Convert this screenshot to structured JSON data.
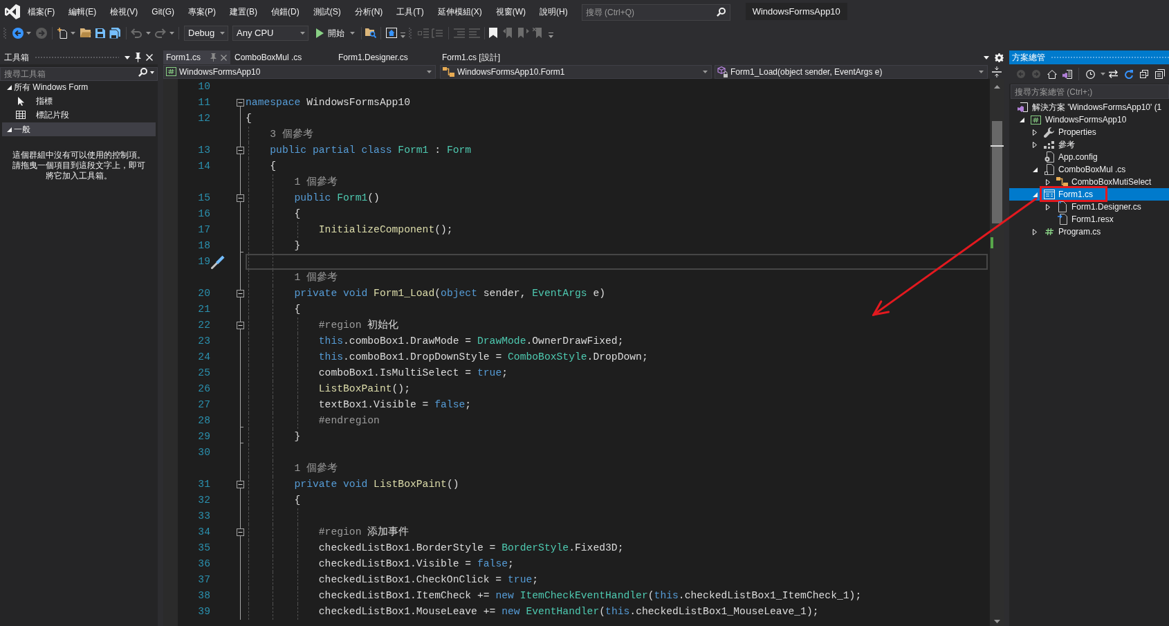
{
  "menu_bar": {
    "items": [
      "檔案(F)",
      "編輯(E)",
      "檢視(V)",
      "Git(G)",
      "專案(P)",
      "建置(B)",
      "偵錯(D)",
      "測試(S)",
      "分析(N)",
      "工具(T)",
      "延伸模組(X)",
      "視窗(W)",
      "說明(H)"
    ],
    "search": {
      "placeholder": "搜尋 (Ctrl+Q)"
    },
    "solution_name": "WindowsFormsApp10"
  },
  "toolbar": {
    "configuration": "Debug",
    "platform": "Any CPU",
    "start": "開始"
  },
  "toolbox": {
    "title": "工具箱",
    "search": {
      "placeholder": "搜尋工具箱"
    },
    "groups": [
      {
        "label": "所有 Windows Form",
        "expanded": true,
        "selected": false,
        "items": [
          {
            "kind": "pointer",
            "label": "指標"
          },
          {
            "kind": "snippets",
            "label": "標記片段"
          }
        ]
      },
      {
        "label": "一般",
        "expanded": true,
        "selected": true,
        "message": "這個群組中沒有可以使用的控制項。請拖曳一個項目到這段文字上，即可將它加入工具箱。"
      }
    ]
  },
  "editor": {
    "tabs": [
      {
        "label": "Form1.cs",
        "selected": true
      },
      {
        "label": "ComboBoxMul .cs",
        "selected": false
      },
      {
        "label": "Form1.Designer.cs",
        "selected": false
      },
      {
        "label": "Form1.cs [設計]",
        "selected": false
      }
    ],
    "navigation": {
      "project": "WindowsFormsApp10",
      "class": "WindowsFormsApp10.Form1",
      "member": "Form1_Load(object sender, EventArgs e)"
    },
    "lines": [
      {
        "kind": "code",
        "number": "10",
        "collapsible": false,
        "block_end": false,
        "current": false
      },
      {
        "kind": "code",
        "number": "11",
        "collapsible": true,
        "block_end": false,
        "current": false,
        "tokens": [
          {
            "kind": "keyword",
            "text": "namespace"
          },
          {
            "kind": "plain",
            "text": " WindowsFormsApp10"
          }
        ]
      },
      {
        "kind": "code",
        "number": "12",
        "collapsible": false,
        "block_end": false,
        "current": false,
        "tokens": [
          {
            "kind": "plain",
            "text": "{"
          }
        ]
      },
      {
        "kind": "codelens",
        "text": "    3 個參考"
      },
      {
        "kind": "code",
        "number": "13",
        "collapsible": true,
        "block_end": false,
        "current": false,
        "tokens": [
          {
            "kind": "keyword",
            "text": "    public partial class "
          },
          {
            "kind": "type",
            "text": "Form1"
          },
          {
            "kind": "plain",
            "text": " : "
          },
          {
            "kind": "type",
            "text": "Form"
          }
        ]
      },
      {
        "kind": "code",
        "number": "14",
        "collapsible": false,
        "block_end": false,
        "current": false,
        "tokens": [
          {
            "kind": "plain",
            "text": "    {"
          }
        ]
      },
      {
        "kind": "codelens",
        "text": "        1 個參考"
      },
      {
        "kind": "code",
        "number": "15",
        "collapsible": true,
        "block_end": false,
        "current": false,
        "tokens": [
          {
            "kind": "keyword",
            "text": "        public "
          },
          {
            "kind": "type",
            "text": "Form1"
          },
          {
            "kind": "plain",
            "text": "()"
          }
        ]
      },
      {
        "kind": "code",
        "number": "16",
        "collapsible": false,
        "block_end": false,
        "current": false,
        "tokens": [
          {
            "kind": "plain",
            "text": "        {"
          }
        ]
      },
      {
        "kind": "code",
        "number": "17",
        "collapsible": false,
        "block_end": false,
        "current": false,
        "tokens": [
          {
            "kind": "method",
            "text": "            InitializeComponent"
          },
          {
            "kind": "plain",
            "text": "();"
          }
        ]
      },
      {
        "kind": "code",
        "number": "18",
        "collapsible": false,
        "block_end": true,
        "current": false,
        "tokens": [
          {
            "kind": "plain",
            "text": "        }"
          }
        ]
      },
      {
        "kind": "code",
        "number": "19",
        "collapsible": false,
        "block_end": false,
        "current": true
      },
      {
        "kind": "codelens",
        "text": "        1 個參考"
      },
      {
        "kind": "code",
        "number": "20",
        "collapsible": true,
        "block_end": false,
        "current": false,
        "tokens": [
          {
            "kind": "keyword",
            "text": "        private void "
          },
          {
            "kind": "method",
            "text": "Form1_Load"
          },
          {
            "kind": "plain",
            "text": "("
          },
          {
            "kind": "keyword",
            "text": "object"
          },
          {
            "kind": "plain",
            "text": " sender, "
          },
          {
            "kind": "type",
            "text": "EventArgs"
          },
          {
            "kind": "plain",
            "text": " e)"
          }
        ]
      },
      {
        "kind": "code",
        "number": "21",
        "collapsible": false,
        "block_end": false,
        "current": false,
        "tokens": [
          {
            "kind": "plain",
            "text": "        {"
          }
        ]
      },
      {
        "kind": "code",
        "number": "22",
        "collapsible": true,
        "block_end": false,
        "current": false,
        "tokens": [
          {
            "kind": "preprocessor",
            "text": "            #region"
          },
          {
            "kind": "plain",
            "text": " 初始化"
          }
        ]
      },
      {
        "kind": "code",
        "number": "23",
        "collapsible": false,
        "block_end": false,
        "current": false,
        "tokens": [
          {
            "kind": "keyword",
            "text": "            this"
          },
          {
            "kind": "plain",
            "text": ".comboBox1.DrawMode = "
          },
          {
            "kind": "type",
            "text": "DrawMode"
          },
          {
            "kind": "plain",
            "text": ".OwnerDrawFixed;"
          }
        ]
      },
      {
        "kind": "code",
        "number": "24",
        "collapsible": false,
        "block_end": false,
        "current": false,
        "tokens": [
          {
            "kind": "keyword",
            "text": "            this"
          },
          {
            "kind": "plain",
            "text": ".comboBox1.DropDownStyle = "
          },
          {
            "kind": "type",
            "text": "ComboBoxStyle"
          },
          {
            "kind": "plain",
            "text": ".DropDown;"
          }
        ]
      },
      {
        "kind": "code",
        "number": "25",
        "collapsible": false,
        "block_end": false,
        "current": false,
        "tokens": [
          {
            "kind": "plain",
            "text": "            comboBox1.IsMultiSelect = "
          },
          {
            "kind": "keyword",
            "text": "true"
          },
          {
            "kind": "plain",
            "text": ";"
          }
        ]
      },
      {
        "kind": "code",
        "number": "26",
        "collapsible": false,
        "block_end": false,
        "current": false,
        "tokens": [
          {
            "kind": "method",
            "text": "            ListBoxPaint"
          },
          {
            "kind": "plain",
            "text": "();"
          }
        ]
      },
      {
        "kind": "code",
        "number": "27",
        "collapsible": false,
        "block_end": false,
        "current": false,
        "tokens": [
          {
            "kind": "plain",
            "text": "            textBox1.Visible = "
          },
          {
            "kind": "keyword",
            "text": "false"
          },
          {
            "kind": "plain",
            "text": ";"
          }
        ]
      },
      {
        "kind": "code",
        "number": "28",
        "collapsible": false,
        "block_end": true,
        "current": false,
        "tokens": [
          {
            "kind": "preprocessor",
            "text": "            #endregion"
          }
        ]
      },
      {
        "kind": "code",
        "number": "29",
        "collapsible": false,
        "block_end": true,
        "current": false,
        "tokens": [
          {
            "kind": "plain",
            "text": "        }"
          }
        ]
      },
      {
        "kind": "code",
        "number": "30",
        "collapsible": false,
        "block_end": false,
        "current": false
      },
      {
        "kind": "codelens",
        "text": "        1 個參考"
      },
      {
        "kind": "code",
        "number": "31",
        "collapsible": true,
        "block_end": false,
        "current": false,
        "tokens": [
          {
            "kind": "keyword",
            "text": "        private void "
          },
          {
            "kind": "method",
            "text": "ListBoxPaint"
          },
          {
            "kind": "plain",
            "text": "()"
          }
        ]
      },
      {
        "kind": "code",
        "number": "32",
        "collapsible": false,
        "block_end": false,
        "current": false,
        "tokens": [
          {
            "kind": "plain",
            "text": "        {"
          }
        ]
      },
      {
        "kind": "code",
        "number": "33",
        "collapsible": false,
        "block_end": false,
        "current": false
      },
      {
        "kind": "code",
        "number": "34",
        "collapsible": true,
        "block_end": false,
        "current": false,
        "tokens": [
          {
            "kind": "preprocessor",
            "text": "            #region"
          },
          {
            "kind": "plain",
            "text": " 添加事件"
          }
        ]
      },
      {
        "kind": "code",
        "number": "35",
        "collapsible": false,
        "block_end": false,
        "current": false,
        "tokens": [
          {
            "kind": "plain",
            "text": "            checkedListBox1.BorderStyle = "
          },
          {
            "kind": "type",
            "text": "BorderStyle"
          },
          {
            "kind": "plain",
            "text": ".Fixed3D;"
          }
        ]
      },
      {
        "kind": "code",
        "number": "36",
        "collapsible": false,
        "block_end": false,
        "current": false,
        "tokens": [
          {
            "kind": "plain",
            "text": "            checkedListBox1.Visible = "
          },
          {
            "kind": "keyword",
            "text": "false"
          },
          {
            "kind": "plain",
            "text": ";"
          }
        ]
      },
      {
        "kind": "code",
        "number": "37",
        "collapsible": false,
        "block_end": false,
        "current": false,
        "tokens": [
          {
            "kind": "plain",
            "text": "            checkedListBox1.CheckOnClick = "
          },
          {
            "kind": "keyword",
            "text": "true"
          },
          {
            "kind": "plain",
            "text": ";"
          }
        ]
      },
      {
        "kind": "code",
        "number": "38",
        "collapsible": false,
        "block_end": false,
        "current": false,
        "tokens": [
          {
            "kind": "plain",
            "text": "            checkedListBox1.ItemCheck += "
          },
          {
            "kind": "keyword",
            "text": "new "
          },
          {
            "kind": "type",
            "text": "ItemCheckEventHandler"
          },
          {
            "kind": "plain",
            "text": "("
          },
          {
            "kind": "keyword",
            "text": "this"
          },
          {
            "kind": "plain",
            "text": ".checkedListBox1_ItemCheck_1);"
          }
        ]
      },
      {
        "kind": "code",
        "number": "39",
        "collapsible": false,
        "block_end": false,
        "current": false,
        "tokens": [
          {
            "kind": "plain",
            "text": "            checkedListBox1.MouseLeave += "
          },
          {
            "kind": "keyword",
            "text": "new "
          },
          {
            "kind": "type",
            "text": "EventHandler"
          },
          {
            "kind": "plain",
            "text": "("
          },
          {
            "kind": "keyword",
            "text": "this"
          },
          {
            "kind": "plain",
            "text": ".checkedListBox1_MouseLeave_1);"
          }
        ]
      }
    ]
  },
  "solution_explorer": {
    "title": "方案總管",
    "search": {
      "placeholder": "搜尋方案總管 (Ctrl+;)"
    },
    "tree": [
      {
        "kind": "solution",
        "label": "解決方案 'WindowsFormsApp10' (1",
        "selected": false,
        "annotated": false,
        "children": [
          {
            "kind": "project",
            "label": "WindowsFormsApp10",
            "expanded": true,
            "selected": false,
            "annotated": false,
            "children": [
              {
                "kind": "properties",
                "label": "Properties",
                "expanded": false,
                "selected": false,
                "annotated": false
              },
              {
                "kind": "references",
                "label": "參考",
                "expanded": false,
                "selected": false,
                "annotated": false
              },
              {
                "kind": "config",
                "label": "App.config",
                "selected": false,
                "annotated": false
              },
              {
                "kind": "code-file",
                "label": "ComboBoxMul .cs",
                "expanded": true,
                "selected": false,
                "annotated": false,
                "children": [
                  {
                    "kind": "class",
                    "label": "ComboBoxMutiSelect",
                    "expanded": false,
                    "selected": false,
                    "annotated": false
                  }
                ]
              },
              {
                "kind": "form",
                "label": "Form1.cs",
                "expanded": true,
                "selected": true,
                "annotated": true,
                "children": [
                  {
                    "kind": "designer-file",
                    "label": "Form1.Designer.cs",
                    "expanded": false,
                    "selected": false,
                    "annotated": false
                  },
                  {
                    "kind": "resource-file",
                    "label": "Form1.resx",
                    "selected": false,
                    "annotated": false
                  }
                ]
              },
              {
                "kind": "csharp-file",
                "label": "Program.cs",
                "expanded": false,
                "selected": false,
                "annotated": false
              }
            ]
          }
        ]
      }
    ]
  }
}
